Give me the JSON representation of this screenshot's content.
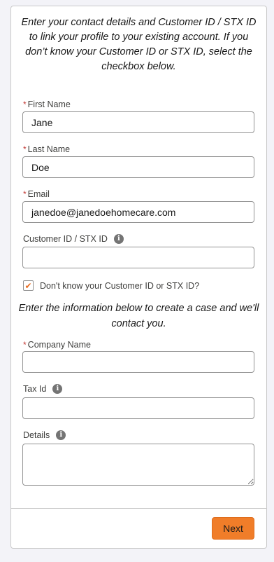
{
  "intro_text": "Enter your contact details and Customer ID / STX ID to link your profile to your existing account. If you don’t know your Customer ID or STX ID, select the checkbox below.",
  "required_marker": "*",
  "fields": {
    "first_name": {
      "label": "First Name",
      "value": "Jane"
    },
    "last_name": {
      "label": "Last Name",
      "value": "Doe"
    },
    "email": {
      "label": "Email",
      "value": "janedoe@janedoehomecare.com"
    },
    "customer_id": {
      "label": "Customer ID / STX ID",
      "value": ""
    },
    "company_name": {
      "label": "Company Name",
      "value": ""
    },
    "tax_id": {
      "label": "Tax Id",
      "value": ""
    },
    "details": {
      "label": "Details",
      "value": ""
    }
  },
  "checkbox": {
    "label": "Don't know your Customer ID or STX ID?",
    "checked": true,
    "check_glyph": "✔"
  },
  "info_glyph": "i",
  "case_text": "Enter the information below to create a case and we'll contact you.",
  "next_button": "Next",
  "colors": {
    "accent": "#f07d29",
    "required": "#c23934"
  }
}
